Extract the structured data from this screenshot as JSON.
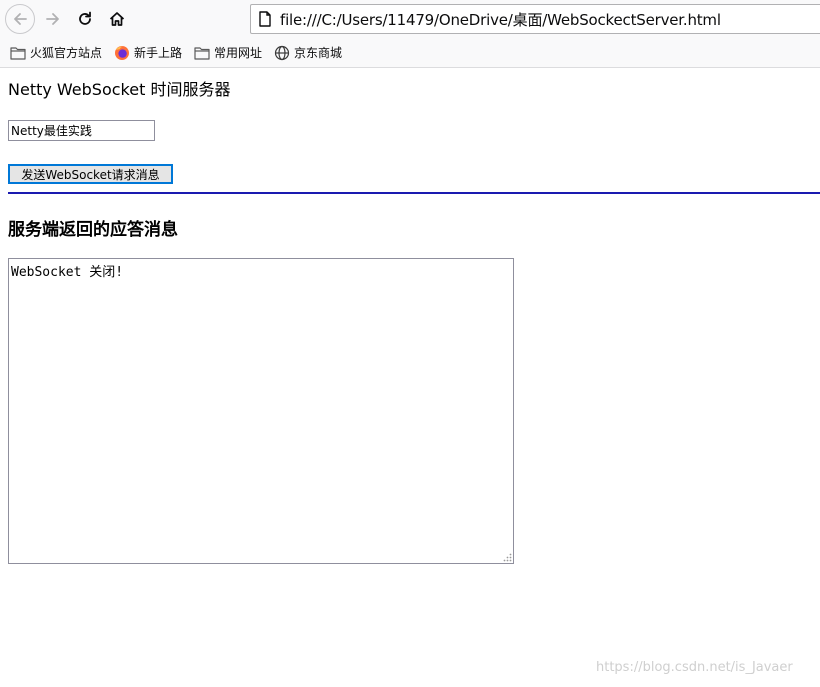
{
  "browser": {
    "url": "file:///C:/Users/11479/OneDrive/桌面/WebSockectServer.html",
    "bookmarks": [
      {
        "label": "火狐官方站点",
        "icon": "folder-icon"
      },
      {
        "label": "新手上路",
        "icon": "firefox-icon"
      },
      {
        "label": "常用网址",
        "icon": "folder-icon"
      },
      {
        "label": "京东商城",
        "icon": "globe-icon"
      }
    ]
  },
  "page": {
    "heading": "Netty WebSocket 时间服务器",
    "message_input_value": "Netty最佳实践",
    "send_button_label": "发送WebSocket请求消息",
    "response_title": "服务端返回的应答消息",
    "response_text": "WebSocket 关闭!"
  },
  "watermark": "https://blog.csdn.net/is_Javaer",
  "colors": {
    "divider": "#1a1ab0",
    "button_focus": "#0078d7"
  }
}
